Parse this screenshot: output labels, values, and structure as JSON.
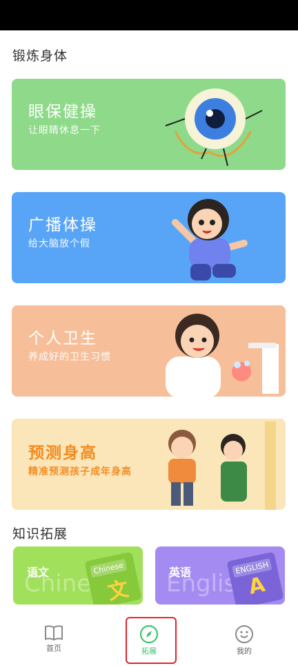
{
  "sections": {
    "exercise_title": "锻炼身体",
    "knowledge_title": "知识拓展"
  },
  "cards": [
    {
      "title": "眼保健操",
      "subtitle": "让眼睛休息一下"
    },
    {
      "title": "广播体操",
      "subtitle": "给大脑放个假"
    },
    {
      "title": "个人卫生",
      "subtitle": "养成好的卫生习惯"
    },
    {
      "title": "预测身高",
      "subtitle": "精准预测孩子成年身高"
    }
  ],
  "mini_cards": [
    {
      "title": "语文",
      "watermark": "Chinese",
      "book_label": "Chinese",
      "book_glyph": "文"
    },
    {
      "title": "英语",
      "watermark": "English",
      "book_label": "ENGLISH",
      "book_glyph": "A"
    }
  ],
  "tabbar": {
    "tabs": [
      {
        "label": "首页",
        "icon": "book-icon"
      },
      {
        "label": "拓展",
        "icon": "compass-icon",
        "active": true
      },
      {
        "label": "我的",
        "icon": "smile-icon"
      }
    ]
  },
  "colors": {
    "eye_card": "#8fd98a",
    "broadcast_card": "#58a5f8",
    "hygiene_card": "#f6bf99",
    "height_card": "#fbe6b9",
    "accent_active": "#3cc46b",
    "highlight_box": "#e0222b"
  }
}
